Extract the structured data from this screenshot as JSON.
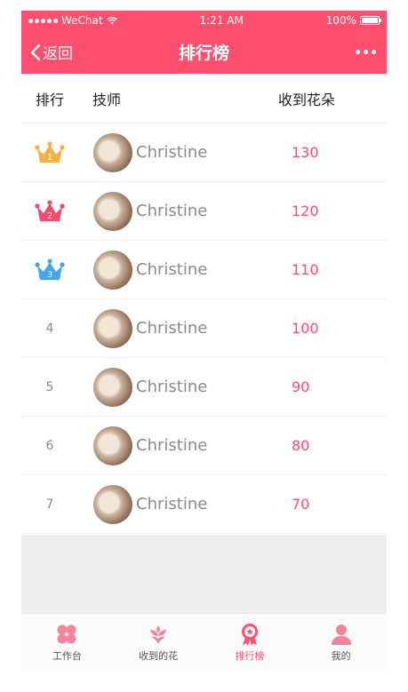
{
  "status_bar": {
    "carrier": "WeChat",
    "time": "1:21 AM",
    "battery": "100%"
  },
  "nav": {
    "back_label": "返回",
    "title": "排行榜"
  },
  "table": {
    "headers": {
      "rank": "排行",
      "technician": "技师",
      "flowers": "收到花朵"
    },
    "rows": [
      {
        "rank": "1",
        "name": "Christine",
        "flowers": "130",
        "badge": "crown-gold"
      },
      {
        "rank": "2",
        "name": "Christine",
        "flowers": "120",
        "badge": "crown-pink"
      },
      {
        "rank": "3",
        "name": "Christine",
        "flowers": "110",
        "badge": "crown-blue"
      },
      {
        "rank": "4",
        "name": "Christine",
        "flowers": "100",
        "badge": ""
      },
      {
        "rank": "5",
        "name": "Christine",
        "flowers": "90",
        "badge": ""
      },
      {
        "rank": "6",
        "name": "Christine",
        "flowers": "80",
        "badge": ""
      },
      {
        "rank": "7",
        "name": "Christine",
        "flowers": "70",
        "badge": ""
      }
    ]
  },
  "tabbar": {
    "items": [
      {
        "label": "工作台",
        "icon": "clover-icon",
        "active": false
      },
      {
        "label": "收到的花",
        "icon": "flower-icon",
        "active": false
      },
      {
        "label": "排行榜",
        "icon": "medal-icon",
        "active": true
      },
      {
        "label": "我的",
        "icon": "profile-icon",
        "active": false
      }
    ]
  },
  "colors": {
    "brand": "#ff4f6e",
    "crown_gold": "#f5b040",
    "crown_pink": "#f04a6d",
    "crown_blue": "#46a3ef"
  }
}
